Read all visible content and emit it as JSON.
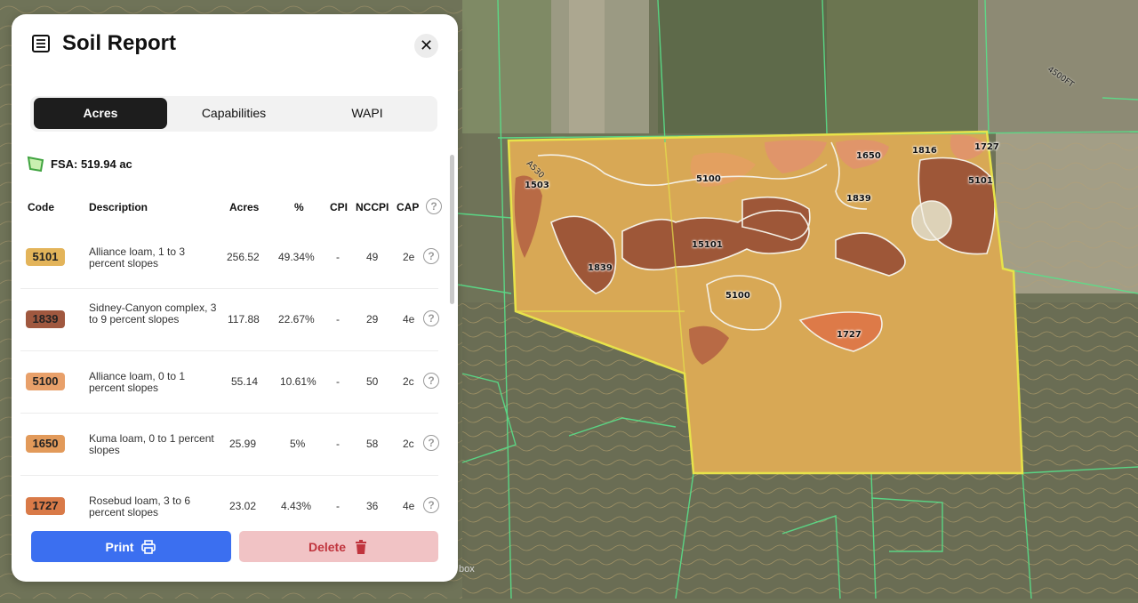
{
  "panel": {
    "title": "Soil Report",
    "close_label": "✕",
    "tabs": [
      {
        "label": "Acres",
        "active": true
      },
      {
        "label": "Capabilities",
        "active": false
      },
      {
        "label": "WAPI",
        "active": false
      }
    ],
    "fsa": "FSA: 519.94 ac",
    "columns": {
      "code": "Code",
      "description": "Description",
      "acres": "Acres",
      "percent": "%",
      "cpi": "CPI",
      "nccpi": "NCCPI",
      "cap": "CAP"
    },
    "rows": [
      {
        "code": "5101",
        "color": "#e3b45a",
        "description": "Alliance loam, 1 to 3 percent slopes",
        "acres": "256.52",
        "percent": "49.34%",
        "cpi": "-",
        "nccpi": "49",
        "cap": "2e"
      },
      {
        "code": "1839",
        "color": "#a0583f",
        "description": "Sidney-Canyon complex, 3 to 9 percent slopes",
        "acres": "117.88",
        "percent": "22.67%",
        "cpi": "-",
        "nccpi": "29",
        "cap": "4e"
      },
      {
        "code": "5100",
        "color": "#e8a06a",
        "description": "Alliance loam, 0 to 1 percent slopes",
        "acres": "55.14",
        "percent": "10.61%",
        "cpi": "-",
        "nccpi": "50",
        "cap": "2c"
      },
      {
        "code": "1650",
        "color": "#e29a5a",
        "description": "Kuma loam, 0 to 1 percent slopes",
        "acres": "25.99",
        "percent": "5%",
        "cpi": "-",
        "nccpi": "58",
        "cap": "2c"
      },
      {
        "code": "1727",
        "color": "#d97a48",
        "description": "Rosebud loam, 3 to 6 percent slopes",
        "acres": "23.02",
        "percent": "4.43%",
        "cpi": "-",
        "nccpi": "36",
        "cap": "4e"
      }
    ],
    "print_label": "Print",
    "delete_label": "Delete"
  },
  "map": {
    "labels": [
      "1503",
      "5100",
      "1650",
      "1816",
      "1727",
      "5101",
      "1839",
      "1839",
      "15101",
      "5100",
      "1727"
    ],
    "road_labels": [
      "4500FT",
      "A530"
    ],
    "attribution": "box"
  },
  "colors": {
    "accent": "#3b6ff0",
    "delete_bg": "#f1c3c5",
    "delete_text": "#c0343d",
    "field_border": "#e7e34a",
    "parcel_lines": "#59e08a"
  }
}
